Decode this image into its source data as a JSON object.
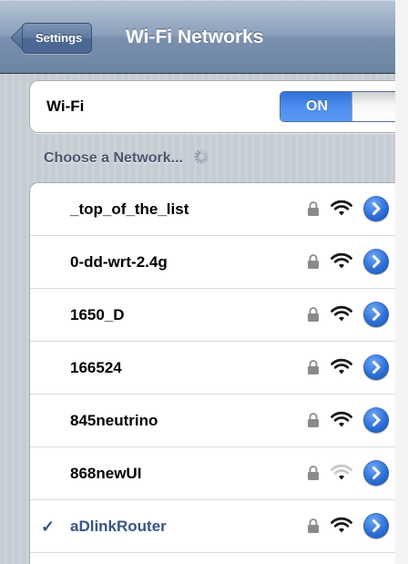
{
  "navbar": {
    "back_label": "Settings",
    "title": "Wi-Fi Networks"
  },
  "wifi_toggle": {
    "label": "Wi-Fi",
    "state_label": "ON",
    "accent": "#3f80e8"
  },
  "section": {
    "header": "Choose a Network..."
  },
  "networks": [
    {
      "name": "_top_of_the_list",
      "secured": true,
      "signal_bars": 3,
      "selected": false
    },
    {
      "name": "0-dd-wrt-2.4g",
      "secured": true,
      "signal_bars": 3,
      "selected": false
    },
    {
      "name": "1650_D",
      "secured": true,
      "signal_bars": 3,
      "selected": false
    },
    {
      "name": "166524",
      "secured": true,
      "signal_bars": 3,
      "selected": false
    },
    {
      "name": "845neutrino",
      "secured": true,
      "signal_bars": 3,
      "selected": false
    },
    {
      "name": "868newUI",
      "secured": true,
      "signal_bars": 1,
      "selected": false
    },
    {
      "name": "aDlinkRouter",
      "secured": true,
      "signal_bars": 3,
      "selected": true,
      "checkmark": "✓"
    }
  ],
  "icons": {
    "lock": "lock-icon",
    "wifi": "wifi-signal-icon",
    "disclosure": "chevron-right-icon",
    "spinner": "activity-spinner-icon"
  },
  "colors": {
    "navbar": "#7a90ae",
    "selected_text": "#385487",
    "disclosure": "#2c6fd6",
    "section_text": "#4c566c"
  }
}
